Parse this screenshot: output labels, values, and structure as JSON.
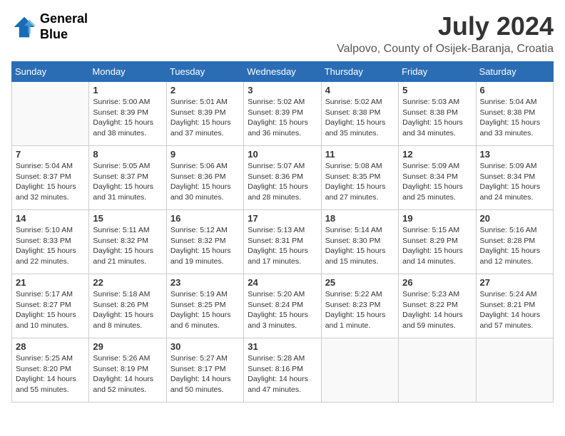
{
  "header": {
    "logo_line1": "General",
    "logo_line2": "Blue",
    "month_year": "July 2024",
    "location": "Valpovo, County of Osijek-Baranja, Croatia"
  },
  "days_of_week": [
    "Sunday",
    "Monday",
    "Tuesday",
    "Wednesday",
    "Thursday",
    "Friday",
    "Saturday"
  ],
  "weeks": [
    [
      {
        "day": "",
        "info": ""
      },
      {
        "day": "1",
        "info": "Sunrise: 5:00 AM\nSunset: 8:39 PM\nDaylight: 15 hours\nand 38 minutes."
      },
      {
        "day": "2",
        "info": "Sunrise: 5:01 AM\nSunset: 8:39 PM\nDaylight: 15 hours\nand 37 minutes."
      },
      {
        "day": "3",
        "info": "Sunrise: 5:02 AM\nSunset: 8:39 PM\nDaylight: 15 hours\nand 36 minutes."
      },
      {
        "day": "4",
        "info": "Sunrise: 5:02 AM\nSunset: 8:38 PM\nDaylight: 15 hours\nand 35 minutes."
      },
      {
        "day": "5",
        "info": "Sunrise: 5:03 AM\nSunset: 8:38 PM\nDaylight: 15 hours\nand 34 minutes."
      },
      {
        "day": "6",
        "info": "Sunrise: 5:04 AM\nSunset: 8:38 PM\nDaylight: 15 hours\nand 33 minutes."
      }
    ],
    [
      {
        "day": "7",
        "info": "Sunrise: 5:04 AM\nSunset: 8:37 PM\nDaylight: 15 hours\nand 32 minutes."
      },
      {
        "day": "8",
        "info": "Sunrise: 5:05 AM\nSunset: 8:37 PM\nDaylight: 15 hours\nand 31 minutes."
      },
      {
        "day": "9",
        "info": "Sunrise: 5:06 AM\nSunset: 8:36 PM\nDaylight: 15 hours\nand 30 minutes."
      },
      {
        "day": "10",
        "info": "Sunrise: 5:07 AM\nSunset: 8:36 PM\nDaylight: 15 hours\nand 28 minutes."
      },
      {
        "day": "11",
        "info": "Sunrise: 5:08 AM\nSunset: 8:35 PM\nDaylight: 15 hours\nand 27 minutes."
      },
      {
        "day": "12",
        "info": "Sunrise: 5:09 AM\nSunset: 8:34 PM\nDaylight: 15 hours\nand 25 minutes."
      },
      {
        "day": "13",
        "info": "Sunrise: 5:09 AM\nSunset: 8:34 PM\nDaylight: 15 hours\nand 24 minutes."
      }
    ],
    [
      {
        "day": "14",
        "info": "Sunrise: 5:10 AM\nSunset: 8:33 PM\nDaylight: 15 hours\nand 22 minutes."
      },
      {
        "day": "15",
        "info": "Sunrise: 5:11 AM\nSunset: 8:32 PM\nDaylight: 15 hours\nand 21 minutes."
      },
      {
        "day": "16",
        "info": "Sunrise: 5:12 AM\nSunset: 8:32 PM\nDaylight: 15 hours\nand 19 minutes."
      },
      {
        "day": "17",
        "info": "Sunrise: 5:13 AM\nSunset: 8:31 PM\nDaylight: 15 hours\nand 17 minutes."
      },
      {
        "day": "18",
        "info": "Sunrise: 5:14 AM\nSunset: 8:30 PM\nDaylight: 15 hours\nand 15 minutes."
      },
      {
        "day": "19",
        "info": "Sunrise: 5:15 AM\nSunset: 8:29 PM\nDaylight: 15 hours\nand 14 minutes."
      },
      {
        "day": "20",
        "info": "Sunrise: 5:16 AM\nSunset: 8:28 PM\nDaylight: 15 hours\nand 12 minutes."
      }
    ],
    [
      {
        "day": "21",
        "info": "Sunrise: 5:17 AM\nSunset: 8:27 PM\nDaylight: 15 hours\nand 10 minutes."
      },
      {
        "day": "22",
        "info": "Sunrise: 5:18 AM\nSunset: 8:26 PM\nDaylight: 15 hours\nand 8 minutes."
      },
      {
        "day": "23",
        "info": "Sunrise: 5:19 AM\nSunset: 8:25 PM\nDaylight: 15 hours\nand 6 minutes."
      },
      {
        "day": "24",
        "info": "Sunrise: 5:20 AM\nSunset: 8:24 PM\nDaylight: 15 hours\nand 3 minutes."
      },
      {
        "day": "25",
        "info": "Sunrise: 5:22 AM\nSunset: 8:23 PM\nDaylight: 15 hours\nand 1 minute."
      },
      {
        "day": "26",
        "info": "Sunrise: 5:23 AM\nSunset: 8:22 PM\nDaylight: 14 hours\nand 59 minutes."
      },
      {
        "day": "27",
        "info": "Sunrise: 5:24 AM\nSunset: 8:21 PM\nDaylight: 14 hours\nand 57 minutes."
      }
    ],
    [
      {
        "day": "28",
        "info": "Sunrise: 5:25 AM\nSunset: 8:20 PM\nDaylight: 14 hours\nand 55 minutes."
      },
      {
        "day": "29",
        "info": "Sunrise: 5:26 AM\nSunset: 8:19 PM\nDaylight: 14 hours\nand 52 minutes."
      },
      {
        "day": "30",
        "info": "Sunrise: 5:27 AM\nSunset: 8:17 PM\nDaylight: 14 hours\nand 50 minutes."
      },
      {
        "day": "31",
        "info": "Sunrise: 5:28 AM\nSunset: 8:16 PM\nDaylight: 14 hours\nand 47 minutes."
      },
      {
        "day": "",
        "info": ""
      },
      {
        "day": "",
        "info": ""
      },
      {
        "day": "",
        "info": ""
      }
    ]
  ]
}
